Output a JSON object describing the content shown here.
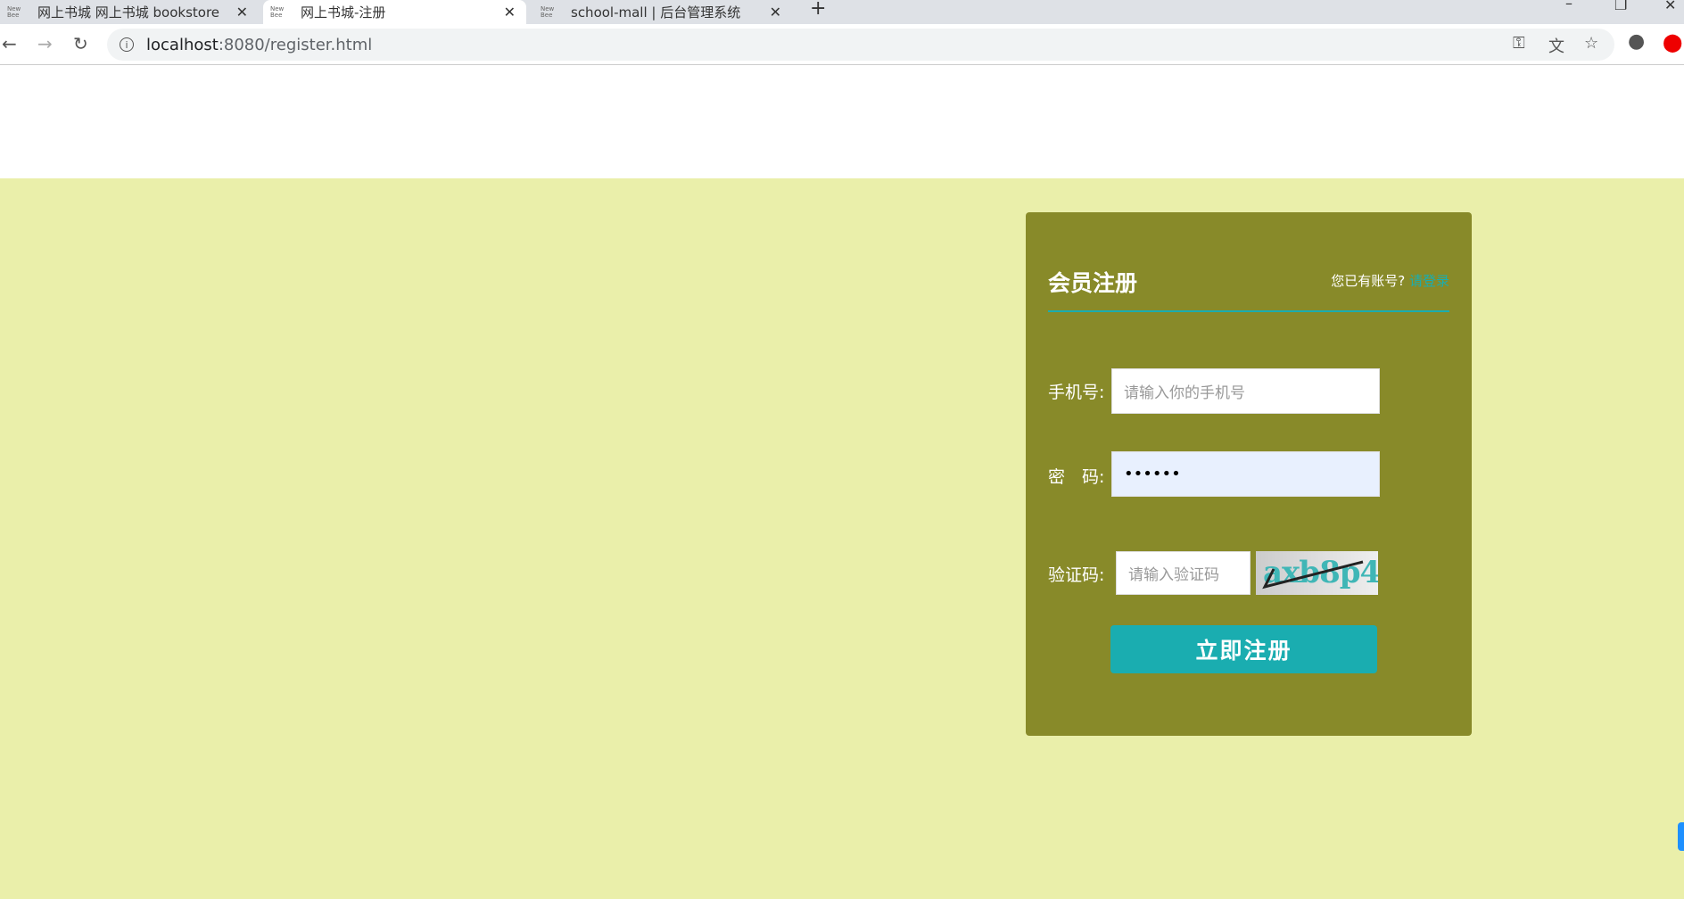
{
  "browser": {
    "tabs": [
      {
        "favicon": "New Bee",
        "label": "网上书城 网上书城 bookstore"
      },
      {
        "favicon": "New Bee",
        "label": "网上书城-注册"
      },
      {
        "favicon": "New Bee",
        "label": "school-mall | 后台管理系统"
      }
    ],
    "url_host": "localhost",
    "url_rest": ":8080/register.html"
  },
  "register": {
    "title": "会员注册",
    "has_account": "您已有账号?",
    "login_link": "请登录",
    "phone_label": "手机号:",
    "phone_placeholder": "请输入你的手机号",
    "password_label": "密　码:",
    "password_value": "••••••",
    "captcha_label": "验证码:",
    "captcha_placeholder": "请输入验证码",
    "captcha_text": "axb8p4",
    "submit": "立即注册"
  },
  "colors": {
    "page_bg": "#eaefaa",
    "card_bg": "#888a29",
    "accent": "#1aadb0"
  }
}
